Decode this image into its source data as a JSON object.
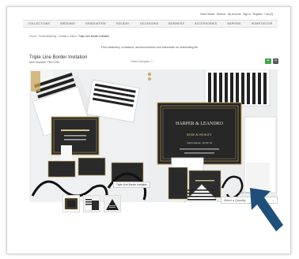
{
  "header": {
    "top_link": "Order Status · Returns · My Account · Sign In / Register · Cart (0)"
  },
  "nav": {
    "items": [
      "COLLECTIONS",
      "WEDDING",
      "GRADUATION",
      "HOLIDAY",
      "OCCASIONS",
      "BUSINESS",
      "ACCESSORIES",
      "NAPKINS",
      "HOME DECOR"
    ]
  },
  "breadcrumb": {
    "items": [
      "Home",
      "Trends/Wedding",
      "Invitation Suites"
    ],
    "separator": "/",
    "current": "Triple Line Border Invitation"
  },
  "promo": "Find stationery, invitations, announcements and essentials for celebrating life.",
  "product": {
    "title": "Triple Line Border Invitation",
    "item_number": "Item Number: TBC1290",
    "samples_link": "Order Samples ⓘ",
    "favorite_icon": "plus-icon",
    "share_icon": "share-icon"
  },
  "invitation_card": {
    "line1": "HARPER & LEANDRO",
    "line2": "ROSE & WESLEY",
    "line3": "SATURDAY, JUNE 20"
  },
  "tooltip": "Triple Line Border Invitation",
  "options": {
    "orientation_label": "Triple Line Border Invitation",
    "quantity_placeholder": "Select a Quantity",
    "quantity_chevron": "⌄"
  },
  "colors": {
    "accent_green": "#3ea84a",
    "arrow_blue": "#1e4f79",
    "gold": "#c9a65a"
  }
}
